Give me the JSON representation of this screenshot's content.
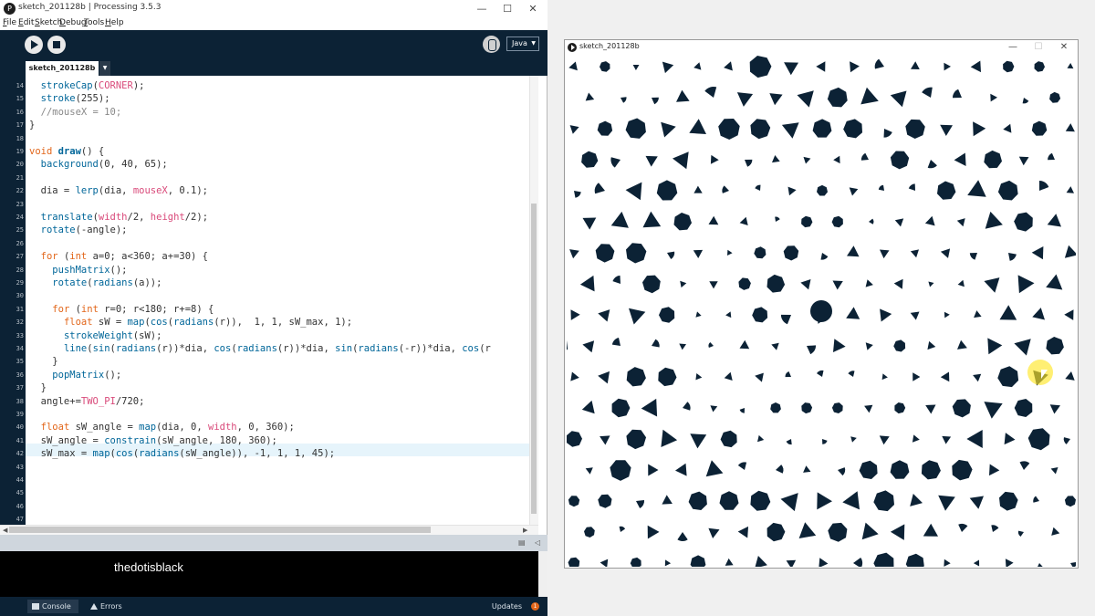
{
  "ide": {
    "title": "sketch_201128b | Processing 3.5.3",
    "app_icon": "processing-icon",
    "controls": {
      "minimize": "—",
      "maximize": "☐",
      "close": "✕"
    },
    "menu": [
      "File",
      "Edit",
      "Sketch",
      "Debug",
      "Tools",
      "Help"
    ],
    "toolbar": {
      "mode": "Java",
      "mode_caret": "▼",
      "run_icon": "play-icon",
      "stop_icon": "stop-icon",
      "debug_icon": "debugger-icon"
    },
    "tab": {
      "name": "sketch_201128b",
      "menu_caret": "▼"
    },
    "code": {
      "line_numbers": [
        "14",
        "15",
        "16",
        "17",
        "18",
        "19",
        "20",
        "21",
        "22",
        "23",
        "24",
        "25",
        "26",
        "27",
        "28",
        "29",
        "30",
        "31",
        "32",
        "33",
        "34",
        "35",
        "36",
        "37",
        "38",
        "39",
        "40",
        "41",
        "42",
        "43",
        "44",
        "45",
        "46",
        "47"
      ],
      "l14": [
        "  ",
        "strokeCap",
        "(",
        "CORNER",
        ");"
      ],
      "l15": [
        "  ",
        "stroke",
        "(255);"
      ],
      "l16": [
        "  //mouseX = 10;"
      ],
      "l17": [
        "}"
      ],
      "l19": [
        "void",
        " ",
        "draw",
        "() {"
      ],
      "l20": [
        "  ",
        "background",
        "(0, 40, 65);"
      ],
      "l22": [
        "  dia = ",
        "lerp",
        "(dia, ",
        "mouseX",
        ", 0.1);"
      ],
      "l24": [
        "  ",
        "translate",
        "(",
        "width",
        "/2, ",
        "height",
        "/2);"
      ],
      "l25": [
        "  ",
        "rotate",
        "(-angle);"
      ],
      "l27": [
        "  ",
        "for",
        " (",
        "int",
        " a=0; a<360; a+=30) {"
      ],
      "l28": [
        "    ",
        "pushMatrix",
        "();"
      ],
      "l29": [
        "    ",
        "rotate",
        "(",
        "radians",
        "(a));"
      ],
      "l31": [
        "    ",
        "for",
        " (",
        "int",
        " r=0; r<180; r+=8) {"
      ],
      "l32": [
        "      ",
        "float",
        " sW = ",
        "map",
        "(",
        "cos",
        "(",
        "radians",
        "(r)),  1, 1, sW_max, 1);"
      ],
      "l33": [
        "      ",
        "strokeWeight",
        "(sW);"
      ],
      "l34": [
        "      ",
        "line",
        "(",
        "sin",
        "(",
        "radians",
        "(r))*dia, ",
        "cos",
        "(",
        "radians",
        "(r))*dia, ",
        "sin",
        "(",
        "radians",
        "(-r))*dia, ",
        "cos",
        "(r"
      ],
      "l35": [
        "    }"
      ],
      "l36": [
        "    ",
        "popMatrix",
        "();"
      ],
      "l37": [
        "  }"
      ],
      "l38": [
        "  angle+=",
        "TWO_PI",
        "/720;"
      ],
      "l40": [
        "  ",
        "float",
        " sW_angle = ",
        "map",
        "(dia, 0, ",
        "width",
        ", 0, 360);"
      ],
      "l41": [
        "  sW_angle = ",
        "constrain",
        "(sW_angle, 180, 360);"
      ],
      "l42": [
        "  sW_max = ",
        "map",
        "(",
        "cos",
        "(",
        "radians",
        "(sW_angle)), -1, 1, 1, 45);"
      ]
    },
    "console_text": "thedotisblack",
    "footer": {
      "console_label": "Console",
      "errors_label": "Errors",
      "updates_label": "Updates",
      "updates_count": "1"
    }
  },
  "sketch": {
    "title": "sketch_201128b",
    "controls": {
      "minimize": "—",
      "maximize": "☐",
      "close": "✕"
    },
    "colors": {
      "background": "#ffffff",
      "shape": "#0c2235",
      "cursor_highlight": "#ffe628"
    }
  }
}
